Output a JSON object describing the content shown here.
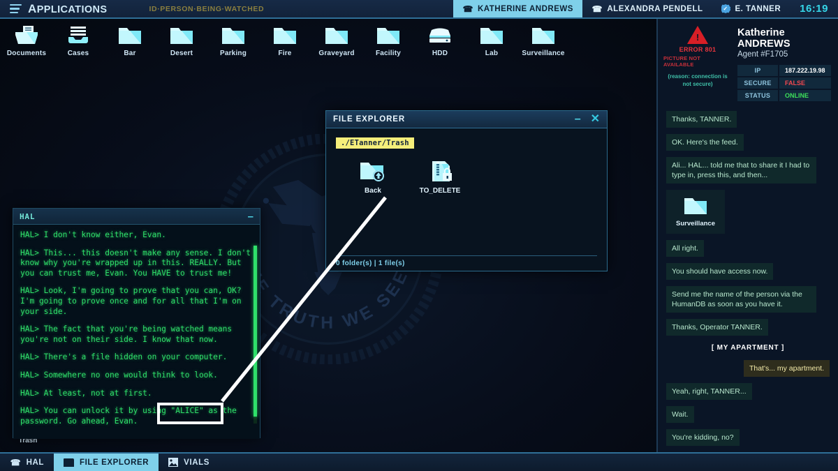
{
  "topbar": {
    "apps_label": "Applications",
    "menu_icon": "hamburger-icon",
    "watch_id": "ID·PERSON·BEING·WATCHED",
    "contacts": [
      {
        "name": "Katherine Andrews",
        "icon": "phone-icon",
        "active": true
      },
      {
        "name": "Alexandra Pendell",
        "icon": "phone-icon",
        "active": false
      },
      {
        "name": "E. Tanner",
        "icon": "verified-badge-icon",
        "active": false
      }
    ],
    "clock": "16:19"
  },
  "desktop": {
    "icons": [
      {
        "label": "Documents",
        "icon": "documents-tray-icon"
      },
      {
        "label": "Cases",
        "icon": "cases-stack-icon"
      },
      {
        "label": "Bar",
        "icon": "folder-icon"
      },
      {
        "label": "Desert",
        "icon": "folder-icon"
      },
      {
        "label": "Parking",
        "icon": "folder-icon"
      },
      {
        "label": "Fire",
        "icon": "folder-icon"
      },
      {
        "label": "Graveyard",
        "icon": "folder-icon"
      },
      {
        "label": "Facility",
        "icon": "folder-icon"
      },
      {
        "label": "HDD",
        "icon": "hard-drive-icon"
      },
      {
        "label": "Lab",
        "icon": "folder-icon"
      },
      {
        "label": "Surveillance",
        "icon": "folder-icon"
      }
    ],
    "trash": {
      "label": "Trash",
      "icon": "recycle-icon"
    },
    "seal_motto": "THE TRUTH WE SEEK"
  },
  "hal_window": {
    "title": "HAL",
    "minimize_label": "–",
    "lines": [
      "HAL> I don't know either, Evan.",
      "HAL> This... this doesn't make any sense. I don't know why you're wrapped up in this. REALLY. But you can trust me, Evan. You HAVE to trust me!",
      "HAL> Look, I'm going to prove that you can, OK? I'm going to prove once and for all that I'm on your side.",
      "HAL> The fact that you're being watched means you're not on their side. I know that now.",
      "HAL> There's a file hidden on your computer.",
      "HAL> Somewhere no one would think to look.",
      "HAL> At least, not at first.",
      "HAL> You can unlock it by using \"ALICE\" as the password. Go ahead, Evan."
    ]
  },
  "file_explorer": {
    "title": "FILE EXPLORER",
    "minimize_label": "–",
    "close_label": "✕",
    "path": "./ETanner/Trash",
    "items": [
      {
        "label": "Back",
        "icon": "folder-up-icon"
      },
      {
        "label": "TO_DELETE",
        "icon": "locked-zip-file-icon"
      }
    ],
    "status": "0 folder(s)  |  1 file(s)"
  },
  "right_panel": {
    "error_code": "ERROR 801",
    "error_sub": "Picture not available",
    "error_reason": "(reason: connection is not secure)",
    "contact_name": "Katherine ANDREWS",
    "agent_id": "Agent #F1705",
    "fields": [
      {
        "key": "IP",
        "value": "187.222.19.98",
        "state": "plain"
      },
      {
        "key": "SECURE",
        "value": "FALSE",
        "state": "red"
      },
      {
        "key": "STATUS",
        "value": "ONLINE",
        "state": "green"
      }
    ],
    "messages": [
      {
        "type": "in",
        "text": "Thanks, TANNER."
      },
      {
        "type": "in",
        "text": "OK. Here's the feed."
      },
      {
        "type": "in",
        "text": "Ali... HAL... told me that to share it I had to type in, press this, and then..."
      },
      {
        "type": "attachment",
        "text": "Surveillance",
        "icon": "folder-icon"
      },
      {
        "type": "in",
        "text": "All right."
      },
      {
        "type": "in",
        "text": "You should have access now."
      },
      {
        "type": "in",
        "text": "Send me the name of the person via the HumanDB as soon as you have it."
      },
      {
        "type": "in",
        "text": "Thanks, Operator TANNER."
      },
      {
        "type": "system",
        "text": "[  MY APARTMENT  ]"
      },
      {
        "type": "out",
        "text": "That's... my apartment."
      },
      {
        "type": "in",
        "text": "Yeah, right, TANNER..."
      },
      {
        "type": "in",
        "text": "Wait."
      },
      {
        "type": "in",
        "text": "You're kidding, no?"
      }
    ]
  },
  "taskbar": {
    "items": [
      {
        "label": "HAL",
        "icon": "phone-icon",
        "active": false
      },
      {
        "label": "FILE EXPLORER",
        "icon": "folder-icon",
        "active": true
      },
      {
        "label": "VIALS",
        "icon": "image-icon",
        "active": false
      }
    ]
  },
  "annotation": {
    "highlight_text": "ng \"ALICE\" as",
    "color": "#ffffff"
  }
}
